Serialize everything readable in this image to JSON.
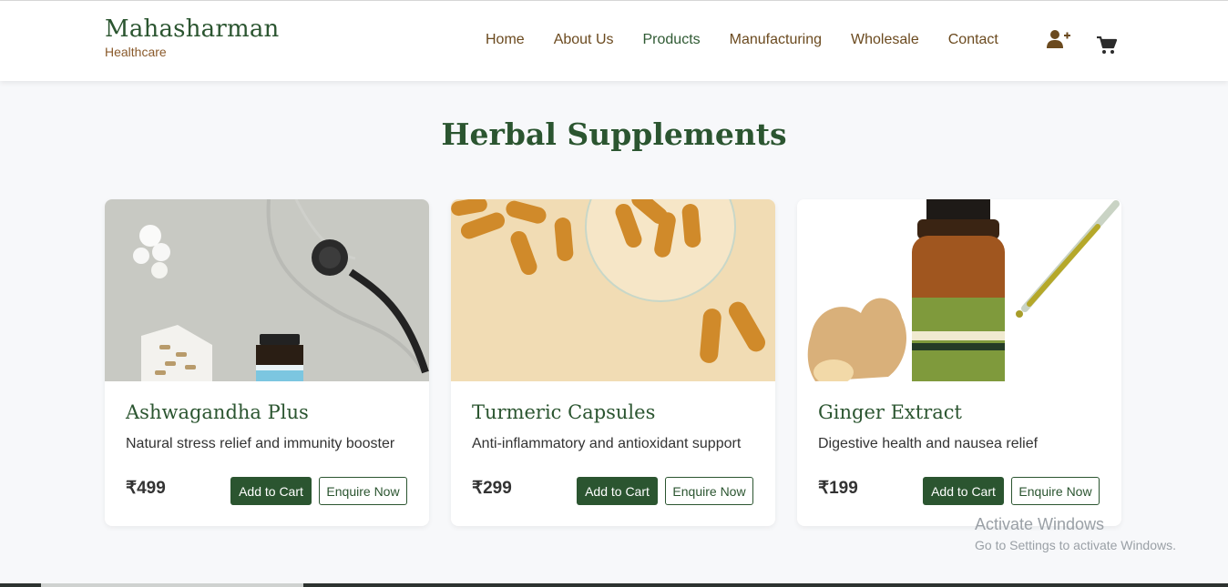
{
  "header": {
    "brand_name": "Mahasharman",
    "brand_sub": "Healthcare",
    "nav": [
      "Home",
      "About Us",
      "Products",
      "Manufacturing",
      "Wholesale",
      "Contact"
    ],
    "icons": {
      "user": "user-plus-icon",
      "cart": "shopping-cart-icon"
    },
    "colors": {
      "brand_green": "#2b5530",
      "nav_brown": "#6b4a1f"
    }
  },
  "section": {
    "title": "Herbal Supplements"
  },
  "products": [
    {
      "name": "Ashwagandha Plus",
      "desc": "Natural stress relief and immunity booster",
      "price": "₹499",
      "add": "Add to Cart",
      "enquire": "Enquire Now"
    },
    {
      "name": "Turmeric Capsules",
      "desc": "Anti-inflammatory and antioxidant support",
      "price": "₹299",
      "add": "Add to Cart",
      "enquire": "Enquire Now"
    },
    {
      "name": "Ginger Extract",
      "desc": "Digestive health and nausea relief",
      "price": "₹199",
      "add": "Add to Cart",
      "enquire": "Enquire Now"
    }
  ],
  "watermark": {
    "title": "Activate Windows",
    "sub": "Go to Settings to activate Windows."
  }
}
